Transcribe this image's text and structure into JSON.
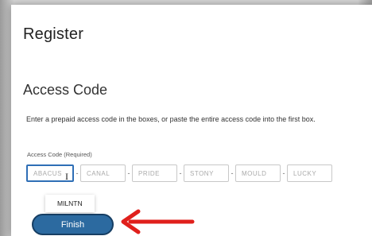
{
  "page": {
    "title": "Register",
    "section_title": "Access Code",
    "instructions": "Enter a prepaid access code in the boxes, or paste the entire access code into the first box.",
    "field_label": "Access Code (Required)"
  },
  "codes": [
    {
      "value": "ABACUS",
      "active": true
    },
    {
      "value": "CANAL"
    },
    {
      "value": "PRIDE"
    },
    {
      "value": "STONY"
    },
    {
      "value": "MOULD"
    },
    {
      "value": "LUCKY"
    }
  ],
  "dropdown": {
    "option": "MILNTN"
  },
  "finish_label": "Finish",
  "colors": {
    "accent": "#2c6aa0",
    "arrow": "#e0201c"
  }
}
